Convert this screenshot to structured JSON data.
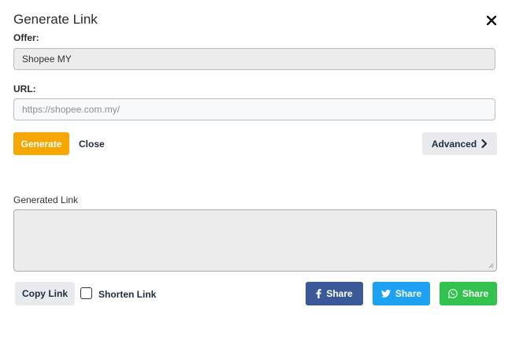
{
  "dialog": {
    "title": "Generate Link"
  },
  "form": {
    "offer_label": "Offer:",
    "offer_value": "Shopee MY",
    "url_label": "URL:",
    "url_placeholder": "https://shopee.com.my/",
    "url_value": ""
  },
  "actions": {
    "generate_label": "Generate",
    "close_label": "Close",
    "advanced_label": "Advanced"
  },
  "output": {
    "generated_label": "Generated Link",
    "generated_value": ""
  },
  "footer": {
    "copy_label": "Copy Link",
    "shorten_label": "Shorten Link",
    "shorten_checked": false,
    "share_facebook_label": "Share",
    "share_twitter_label": "Share",
    "share_whatsapp_label": "Share"
  },
  "colors": {
    "generate": "#f7a800",
    "facebook": "#3b5998",
    "twitter": "#1da1f2",
    "whatsapp": "#33c24d"
  },
  "icons": {
    "close": "close-icon",
    "advanced": "chevron-right-icon",
    "facebook": "facebook-icon",
    "twitter": "twitter-icon",
    "whatsapp": "whatsapp-icon",
    "resize": "resize-grip-icon"
  }
}
